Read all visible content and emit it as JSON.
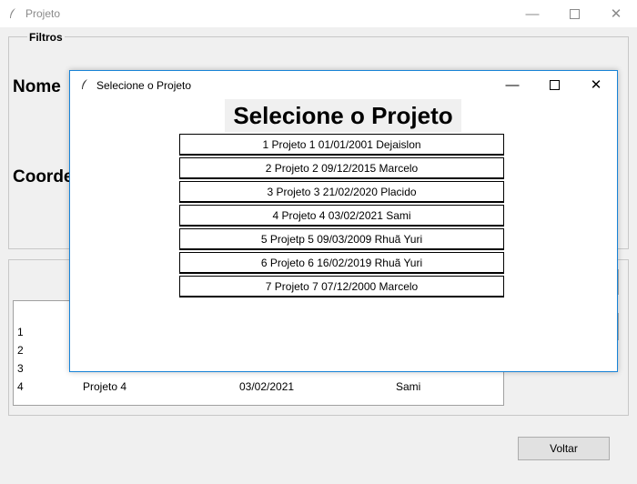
{
  "main_window": {
    "title": "Projeto",
    "filters_label": "Filtros",
    "name_label": "Nome",
    "coord_label": "Coorde",
    "list_rows": [
      {
        "id": "1",
        "name": "",
        "date": "",
        "person": ""
      },
      {
        "id": "2",
        "name": "",
        "date": "",
        "person": ""
      },
      {
        "id": "3",
        "name": "",
        "date": "",
        "person": ""
      },
      {
        "id": "4",
        "name": "Projeto 4",
        "date": "03/02/2021",
        "person": "Sami"
      }
    ],
    "back_button": "Voltar"
  },
  "dialog": {
    "title": "Selecione o Projeto",
    "heading": "Selecione o Projeto",
    "projects": [
      "1  Projeto 1  01/01/2001  Dejaislon",
      "2  Projeto 2  09/12/2015  Marcelo",
      "3  Projeto 3  21/02/2020  Placido",
      "4  Projeto 4  03/02/2021  Sami",
      "5  Projetp 5  09/03/2009  Rhuã Yuri",
      "6  Projeto 6  16/02/2019  Rhuã Yuri",
      "7  Projeto 7  07/12/2000  Marcelo"
    ]
  },
  "icons": {
    "app_icon": "feather-icon",
    "minimize": "minimize-icon",
    "maximize": "maximize-icon",
    "close": "close-icon"
  },
  "colors": {
    "dialog_border": "#1883d7",
    "window_bg": "#f0f0f0"
  }
}
